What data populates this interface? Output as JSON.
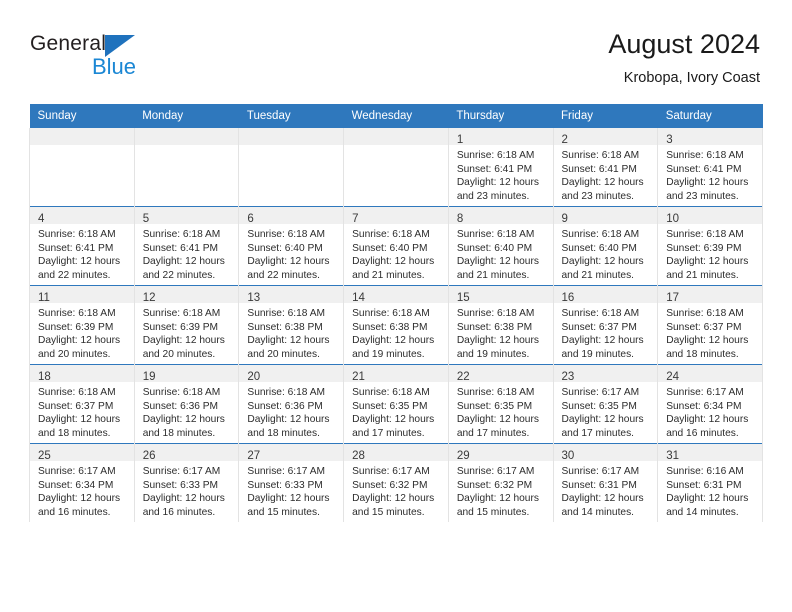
{
  "logo": {
    "word_one": "General",
    "word_two": "Blue",
    "triangle_color": "#1f72bd",
    "blue_text_color": "#1b87d4"
  },
  "header": {
    "title": "August 2024",
    "subtitle": "Krobopa, Ivory Coast"
  },
  "calendar": {
    "header_bg": "#2f78bd",
    "header_text_color": "#ffffff",
    "row_divider_color": "#2f78bd",
    "daynum_strip_bg": "#f0f0f0",
    "weekday_headers": [
      "Sunday",
      "Monday",
      "Tuesday",
      "Wednesday",
      "Thursday",
      "Friday",
      "Saturday"
    ],
    "weeks": [
      [
        {
          "day": "",
          "empty": true,
          "lines": []
        },
        {
          "day": "",
          "empty": true,
          "lines": []
        },
        {
          "day": "",
          "empty": true,
          "lines": []
        },
        {
          "day": "",
          "empty": true,
          "lines": []
        },
        {
          "day": "1",
          "empty": false,
          "lines": [
            "Sunrise: 6:18 AM",
            "Sunset: 6:41 PM",
            "Daylight: 12 hours",
            "and 23 minutes."
          ]
        },
        {
          "day": "2",
          "empty": false,
          "lines": [
            "Sunrise: 6:18 AM",
            "Sunset: 6:41 PM",
            "Daylight: 12 hours",
            "and 23 minutes."
          ]
        },
        {
          "day": "3",
          "empty": false,
          "lines": [
            "Sunrise: 6:18 AM",
            "Sunset: 6:41 PM",
            "Daylight: 12 hours",
            "and 23 minutes."
          ]
        }
      ],
      [
        {
          "day": "4",
          "empty": false,
          "lines": [
            "Sunrise: 6:18 AM",
            "Sunset: 6:41 PM",
            "Daylight: 12 hours",
            "and 22 minutes."
          ]
        },
        {
          "day": "5",
          "empty": false,
          "lines": [
            "Sunrise: 6:18 AM",
            "Sunset: 6:41 PM",
            "Daylight: 12 hours",
            "and 22 minutes."
          ]
        },
        {
          "day": "6",
          "empty": false,
          "lines": [
            "Sunrise: 6:18 AM",
            "Sunset: 6:40 PM",
            "Daylight: 12 hours",
            "and 22 minutes."
          ]
        },
        {
          "day": "7",
          "empty": false,
          "lines": [
            "Sunrise: 6:18 AM",
            "Sunset: 6:40 PM",
            "Daylight: 12 hours",
            "and 21 minutes."
          ]
        },
        {
          "day": "8",
          "empty": false,
          "lines": [
            "Sunrise: 6:18 AM",
            "Sunset: 6:40 PM",
            "Daylight: 12 hours",
            "and 21 minutes."
          ]
        },
        {
          "day": "9",
          "empty": false,
          "lines": [
            "Sunrise: 6:18 AM",
            "Sunset: 6:40 PM",
            "Daylight: 12 hours",
            "and 21 minutes."
          ]
        },
        {
          "day": "10",
          "empty": false,
          "lines": [
            "Sunrise: 6:18 AM",
            "Sunset: 6:39 PM",
            "Daylight: 12 hours",
            "and 21 minutes."
          ]
        }
      ],
      [
        {
          "day": "11",
          "empty": false,
          "lines": [
            "Sunrise: 6:18 AM",
            "Sunset: 6:39 PM",
            "Daylight: 12 hours",
            "and 20 minutes."
          ]
        },
        {
          "day": "12",
          "empty": false,
          "lines": [
            "Sunrise: 6:18 AM",
            "Sunset: 6:39 PM",
            "Daylight: 12 hours",
            "and 20 minutes."
          ]
        },
        {
          "day": "13",
          "empty": false,
          "lines": [
            "Sunrise: 6:18 AM",
            "Sunset: 6:38 PM",
            "Daylight: 12 hours",
            "and 20 minutes."
          ]
        },
        {
          "day": "14",
          "empty": false,
          "lines": [
            "Sunrise: 6:18 AM",
            "Sunset: 6:38 PM",
            "Daylight: 12 hours",
            "and 19 minutes."
          ]
        },
        {
          "day": "15",
          "empty": false,
          "lines": [
            "Sunrise: 6:18 AM",
            "Sunset: 6:38 PM",
            "Daylight: 12 hours",
            "and 19 minutes."
          ]
        },
        {
          "day": "16",
          "empty": false,
          "lines": [
            "Sunrise: 6:18 AM",
            "Sunset: 6:37 PM",
            "Daylight: 12 hours",
            "and 19 minutes."
          ]
        },
        {
          "day": "17",
          "empty": false,
          "lines": [
            "Sunrise: 6:18 AM",
            "Sunset: 6:37 PM",
            "Daylight: 12 hours",
            "and 18 minutes."
          ]
        }
      ],
      [
        {
          "day": "18",
          "empty": false,
          "lines": [
            "Sunrise: 6:18 AM",
            "Sunset: 6:37 PM",
            "Daylight: 12 hours",
            "and 18 minutes."
          ]
        },
        {
          "day": "19",
          "empty": false,
          "lines": [
            "Sunrise: 6:18 AM",
            "Sunset: 6:36 PM",
            "Daylight: 12 hours",
            "and 18 minutes."
          ]
        },
        {
          "day": "20",
          "empty": false,
          "lines": [
            "Sunrise: 6:18 AM",
            "Sunset: 6:36 PM",
            "Daylight: 12 hours",
            "and 18 minutes."
          ]
        },
        {
          "day": "21",
          "empty": false,
          "lines": [
            "Sunrise: 6:18 AM",
            "Sunset: 6:35 PM",
            "Daylight: 12 hours",
            "and 17 minutes."
          ]
        },
        {
          "day": "22",
          "empty": false,
          "lines": [
            "Sunrise: 6:18 AM",
            "Sunset: 6:35 PM",
            "Daylight: 12 hours",
            "and 17 minutes."
          ]
        },
        {
          "day": "23",
          "empty": false,
          "lines": [
            "Sunrise: 6:17 AM",
            "Sunset: 6:35 PM",
            "Daylight: 12 hours",
            "and 17 minutes."
          ]
        },
        {
          "day": "24",
          "empty": false,
          "lines": [
            "Sunrise: 6:17 AM",
            "Sunset: 6:34 PM",
            "Daylight: 12 hours",
            "and 16 minutes."
          ]
        }
      ],
      [
        {
          "day": "25",
          "empty": false,
          "lines": [
            "Sunrise: 6:17 AM",
            "Sunset: 6:34 PM",
            "Daylight: 12 hours",
            "and 16 minutes."
          ]
        },
        {
          "day": "26",
          "empty": false,
          "lines": [
            "Sunrise: 6:17 AM",
            "Sunset: 6:33 PM",
            "Daylight: 12 hours",
            "and 16 minutes."
          ]
        },
        {
          "day": "27",
          "empty": false,
          "lines": [
            "Sunrise: 6:17 AM",
            "Sunset: 6:33 PM",
            "Daylight: 12 hours",
            "and 15 minutes."
          ]
        },
        {
          "day": "28",
          "empty": false,
          "lines": [
            "Sunrise: 6:17 AM",
            "Sunset: 6:32 PM",
            "Daylight: 12 hours",
            "and 15 minutes."
          ]
        },
        {
          "day": "29",
          "empty": false,
          "lines": [
            "Sunrise: 6:17 AM",
            "Sunset: 6:32 PM",
            "Daylight: 12 hours",
            "and 15 minutes."
          ]
        },
        {
          "day": "30",
          "empty": false,
          "lines": [
            "Sunrise: 6:17 AM",
            "Sunset: 6:31 PM",
            "Daylight: 12 hours",
            "and 14 minutes."
          ]
        },
        {
          "day": "31",
          "empty": false,
          "lines": [
            "Sunrise: 6:16 AM",
            "Sunset: 6:31 PM",
            "Daylight: 12 hours",
            "and 14 minutes."
          ]
        }
      ]
    ]
  }
}
